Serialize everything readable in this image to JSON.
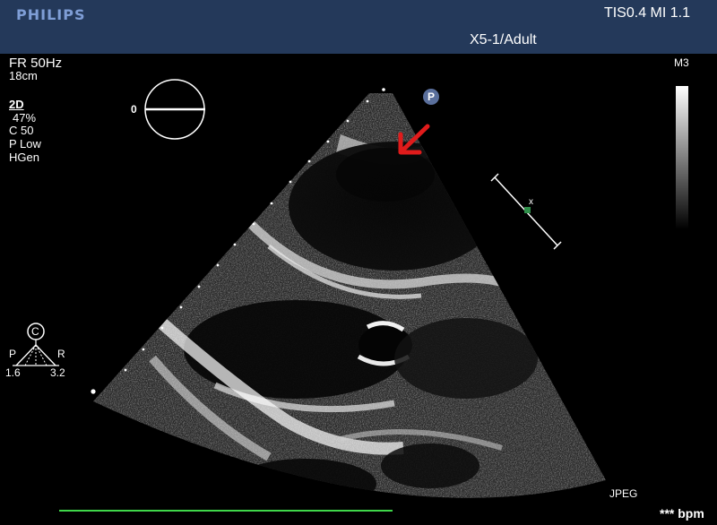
{
  "header": {
    "brand": "PHILIPS",
    "tis_mi": "TIS0.4   MI 1.1",
    "probe_preset": "X5-1/Adult"
  },
  "params": {
    "frame_rate": "FR 50Hz",
    "depth": "18cm",
    "mode": "2D",
    "gain": "47%",
    "compression": "C 50",
    "power": "P Low",
    "frequency": "HGen"
  },
  "orientation": {
    "angle": "0"
  },
  "marker": {
    "label": "P"
  },
  "grayscale_map": "M3",
  "position_icon": {
    "letter": "C",
    "left_label": "P",
    "right_label": "R",
    "left_value": "1.6",
    "right_value": "3.2"
  },
  "format": "JPEG",
  "heart_rate": "*** bpm",
  "colors": {
    "header_bg": "#24395a",
    "brand": "#7f9ed6",
    "arrow": "#e01b1b",
    "ecg": "#3fd64a",
    "focus_marker": "#2f8f4a"
  }
}
